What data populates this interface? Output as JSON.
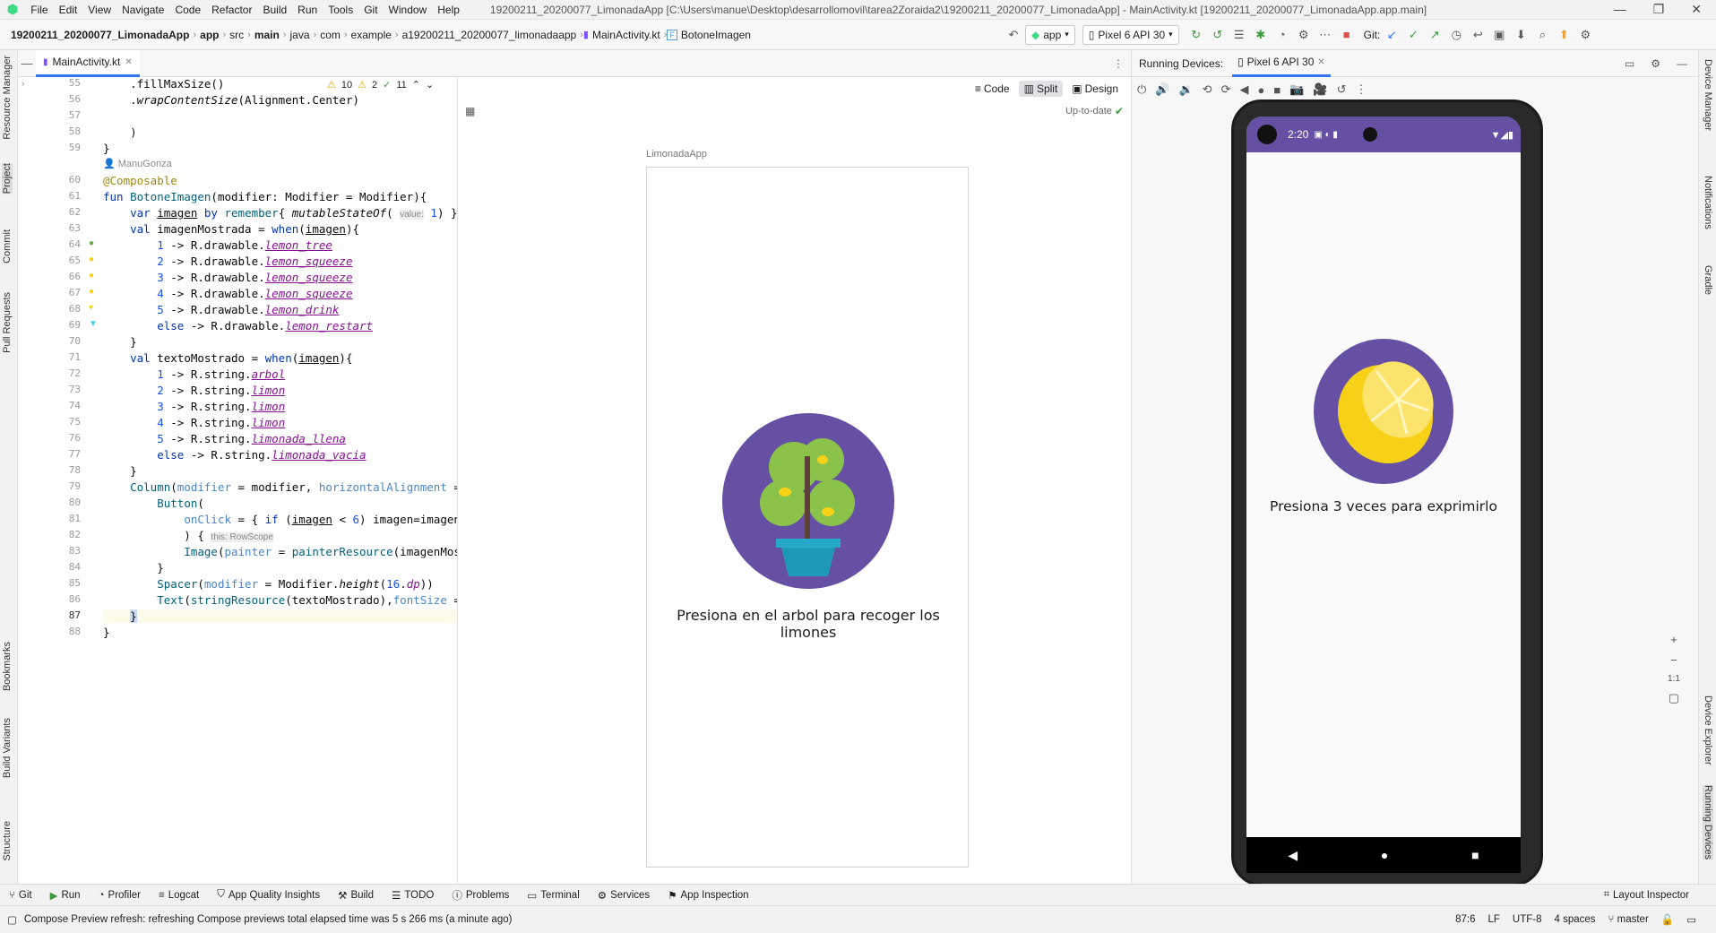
{
  "window": {
    "title": "19200211_20200077_LimonadaApp [C:\\Users\\manue\\Desktop\\desarrollomovil\\tarea2Zoraida2\\19200211_20200077_LimonadaApp] - MainActivity.kt [19200211_20200077_LimonadaApp.app.main]"
  },
  "menu": [
    "File",
    "Edit",
    "View",
    "Navigate",
    "Code",
    "Refactor",
    "Build",
    "Run",
    "Tools",
    "Git",
    "Window",
    "Help"
  ],
  "breadcrumb": [
    "19200211_20200077_LimonadaApp",
    "app",
    "src",
    "main",
    "java",
    "com",
    "example",
    "a19200211_20200077_limonadaapp",
    "MainActivity.kt",
    "BotoneImagen"
  ],
  "toolbar": {
    "run_config": "app",
    "device": "Pixel 6 API 30",
    "git_label": "Git:"
  },
  "left_tabs": [
    "Resource Manager",
    "Project",
    "Commit",
    "Pull Requests",
    "Bookmarks",
    "Build Variants",
    "Structure"
  ],
  "right_tabs": [
    "Device Manager",
    "Notifications",
    "Gradle",
    "Device Explorer",
    "Running Devices"
  ],
  "editor": {
    "file_tab": "MainActivity.kt",
    "inspections": {
      "warnings": "10",
      "weak": "2",
      "typos": "11"
    },
    "author_hint": "ManuGonza",
    "line_numbers": [
      "55",
      "56",
      "57",
      "58",
      "59",
      "60",
      "61",
      "62",
      "63",
      "64",
      "65",
      "66",
      "67",
      "68",
      "69",
      "70",
      "71",
      "72",
      "73",
      "74",
      "75",
      "76",
      "77",
      "78",
      "79",
      "80",
      "81",
      "82",
      "83",
      "84",
      "85",
      "86",
      "87",
      "88"
    ]
  },
  "preview": {
    "modes": [
      "Code",
      "Split",
      "Design"
    ],
    "status": "Up-to-date",
    "frame_title": "LimonadaApp",
    "caption": "Presiona en el arbol para recoger los limones"
  },
  "running": {
    "title": "Running Devices:",
    "device_tab": "Pixel 6 API 30",
    "time": "2:20",
    "caption": "Presiona 3 veces para exprimirlo",
    "zoom": {
      "in": "+",
      "out": "−",
      "fit": "1:1"
    }
  },
  "bottom_tools": [
    "Git",
    "Run",
    "Profiler",
    "Logcat",
    "App Quality Insights",
    "Build",
    "TODO",
    "Problems",
    "Terminal",
    "Services",
    "App Inspection"
  ],
  "layout_inspector": "Layout Inspector",
  "status": {
    "message": "Compose Preview refresh: refreshing Compose previews total elapsed time was 5 s 266 ms (a minute ago)",
    "position": "87:6",
    "line_sep": "LF",
    "encoding": "UTF-8",
    "indent": "4 spaces",
    "branch": "master"
  },
  "colors": {
    "accent": "#3574f0",
    "android_purple": "#6650a4",
    "lemon": "#f7d117",
    "tree_green": "#8bc34a",
    "pot": "#26a9c9"
  }
}
